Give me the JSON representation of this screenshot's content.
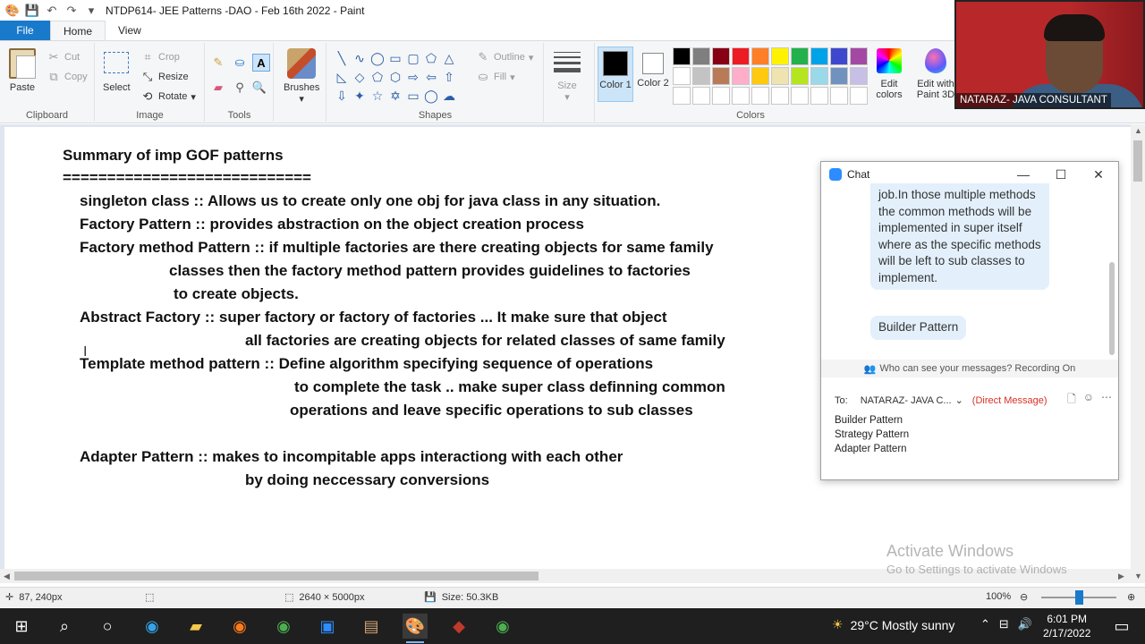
{
  "titlebar": {
    "title": "NTDP614- JEE Patterns -DAO - Feb 16th 2022 - Paint"
  },
  "tabs": {
    "file": "File",
    "home": "Home",
    "view": "View"
  },
  "ribbon": {
    "clipboard": {
      "paste": "Paste",
      "cut": "Cut",
      "copy": "Copy",
      "label": "Clipboard"
    },
    "image": {
      "select": "Select",
      "crop": "Crop",
      "resize": "Resize",
      "rotate": "Rotate",
      "label": "Image"
    },
    "tools": {
      "label": "Tools"
    },
    "brushes": {
      "label": "Brushes"
    },
    "shapes": {
      "outline": "Outline",
      "fill": "Fill",
      "label": "Shapes"
    },
    "size": {
      "label": "Size"
    },
    "colors": {
      "color1": "Color 1",
      "color2": "Color 2",
      "edit_colors": "Edit colors",
      "edit_paint3d": "Edit with Paint 3D",
      "label": "Colors",
      "color1_value": "#000000",
      "color2_value": "#ffffff",
      "palette": [
        "#000000",
        "#7f7f7f",
        "#880015",
        "#ed1c24",
        "#ff7f27",
        "#fff200",
        "#22b14c",
        "#00a2e8",
        "#3f48cc",
        "#a349a4",
        "#ffffff",
        "#c3c3c3",
        "#b97a57",
        "#ffaec9",
        "#ffc90e",
        "#efe4b0",
        "#b5e61d",
        "#99d9ea",
        "#7092be",
        "#c8bfe7",
        "#ffffff",
        "#ffffff",
        "#ffffff",
        "#ffffff",
        "#ffffff",
        "#ffffff",
        "#ffffff",
        "#ffffff",
        "#ffffff",
        "#ffffff"
      ]
    }
  },
  "canvas": {
    "lines": [
      "Summary of  imp  GOF patterns",
      "============================",
      "singleton class  ::  Allows us to create only one obj for java class in any situation.",
      "Factory Pattern  ::  provides abstraction on the object creation process",
      "Factory method Pattern :: if multiple factories are there creating objects for same family",
      "classes then the factory method pattern provides  guidelines to factories",
      "to create objects.",
      "Abstract Factory  ::  super factory or  factory of factories ... It make sure that object",
      "all factories are creating objects  for related classes of same family",
      "Template method pattern ::   Define algorithm specifying sequence of operations",
      "to complete the task .. make super class definning common",
      "operations and leave specific operations to sub classes",
      "Adapter  Pattern ::  makes   to incompitable apps  interactiong with each other",
      "by doing neccessary conversions"
    ]
  },
  "chat": {
    "title": "Chat",
    "message_1": "job.In those multiple methods the common methods will be implemented in super itself where as the specific methods will be left to sub classes to implement.",
    "message_2": "Builder Pattern",
    "privacy": "Who can see your messages? Recording On",
    "to_label": "To:",
    "recipient": "NATARAZ- JAVA C...",
    "direct_message": "(Direct Message)",
    "draft_lines": [
      "Builder Pattern",
      "Strategy Pattern",
      "Adapter Pattern"
    ]
  },
  "webcam": {
    "name": "NATARAZ- JAVA CONSULTANT"
  },
  "status": {
    "cursor_pos": "87, 240px",
    "dimensions": "2640 × 5000px",
    "size": "Size: 50.3KB",
    "zoom": "100%"
  },
  "watermark": {
    "line1": "Activate Windows",
    "line2": "Go to Settings to activate Windows"
  },
  "taskbar": {
    "weather": "29°C  Mostly sunny",
    "time": "6:01 PM",
    "date": "2/17/2022"
  }
}
